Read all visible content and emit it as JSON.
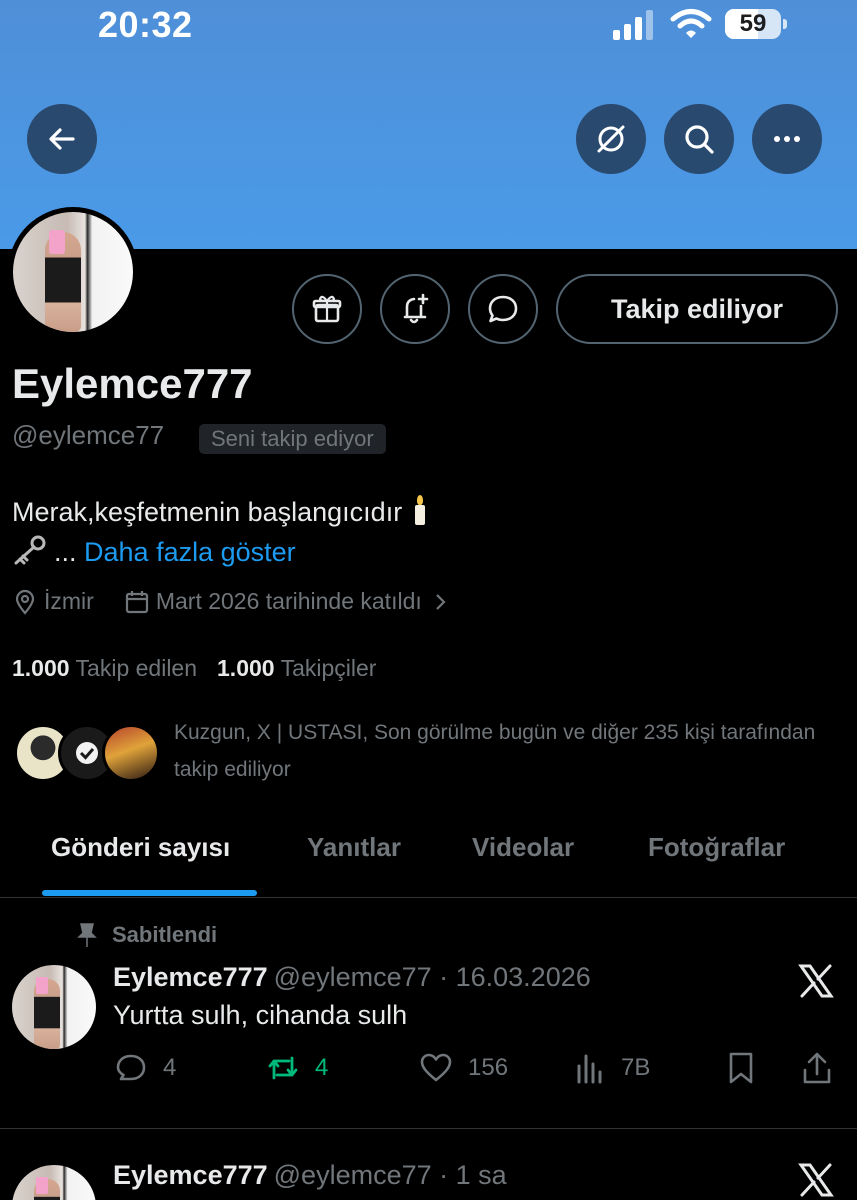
{
  "status_bar": {
    "time": "20:32",
    "battery": "59",
    "battery_level": 0.59
  },
  "profile": {
    "display_name": "Eylemce777",
    "handle": "@eylemce77",
    "follows_you_badge": "Seni takip ediyor",
    "follow_button_label": "Takip ediliyor",
    "bio_line1": "Merak,keşfetmenin başlangıcıdır",
    "bio_line2_prefix": "...",
    "bio_more": "Daha fazla göster",
    "location": "İzmir",
    "joined": "Mart 2026 tarihinde katıldı",
    "following_count": "1.000",
    "following_label": "Takip edilen",
    "followers_count": "1.000",
    "followers_label": "Takipçiler",
    "followed_by_text": "Kuzgun, X | USTASI, Son görülme bugün ve diğer 235 kişi tarafından takip ediliyor"
  },
  "tabs": [
    {
      "label": "Gönderi sayısı",
      "active": true
    },
    {
      "label": "Yanıtlar",
      "active": false
    },
    {
      "label": "Videolar",
      "active": false
    },
    {
      "label": "Fotoğraflar",
      "active": false
    }
  ],
  "posts": [
    {
      "pinned_label": "Sabitlendi",
      "name": "Eylemce777",
      "meta": "@eylemce77 · 16.03.2026",
      "text": "Yurtta sulh, cihanda sulh",
      "replies": "4",
      "reposts": "4",
      "likes": "156",
      "views": "7B"
    },
    {
      "name": "Eylemce777",
      "meta": "@eylemce77 · 1 sa"
    }
  ],
  "icons": {
    "back": "back-arrow-icon",
    "grok": "grok-icon",
    "search": "search-icon",
    "more": "more-icon",
    "gift": "gift-icon",
    "notify": "bell-plus-icon",
    "message": "message-icon",
    "location": "location-pin-icon",
    "calendar": "calendar-icon",
    "pin": "pin-icon",
    "x_logo": "x-logo-icon"
  },
  "colors": {
    "accent": "#1d9bf0",
    "repost": "#00ba7c",
    "banner": "#4a9ae8",
    "muted": "#71767b"
  }
}
